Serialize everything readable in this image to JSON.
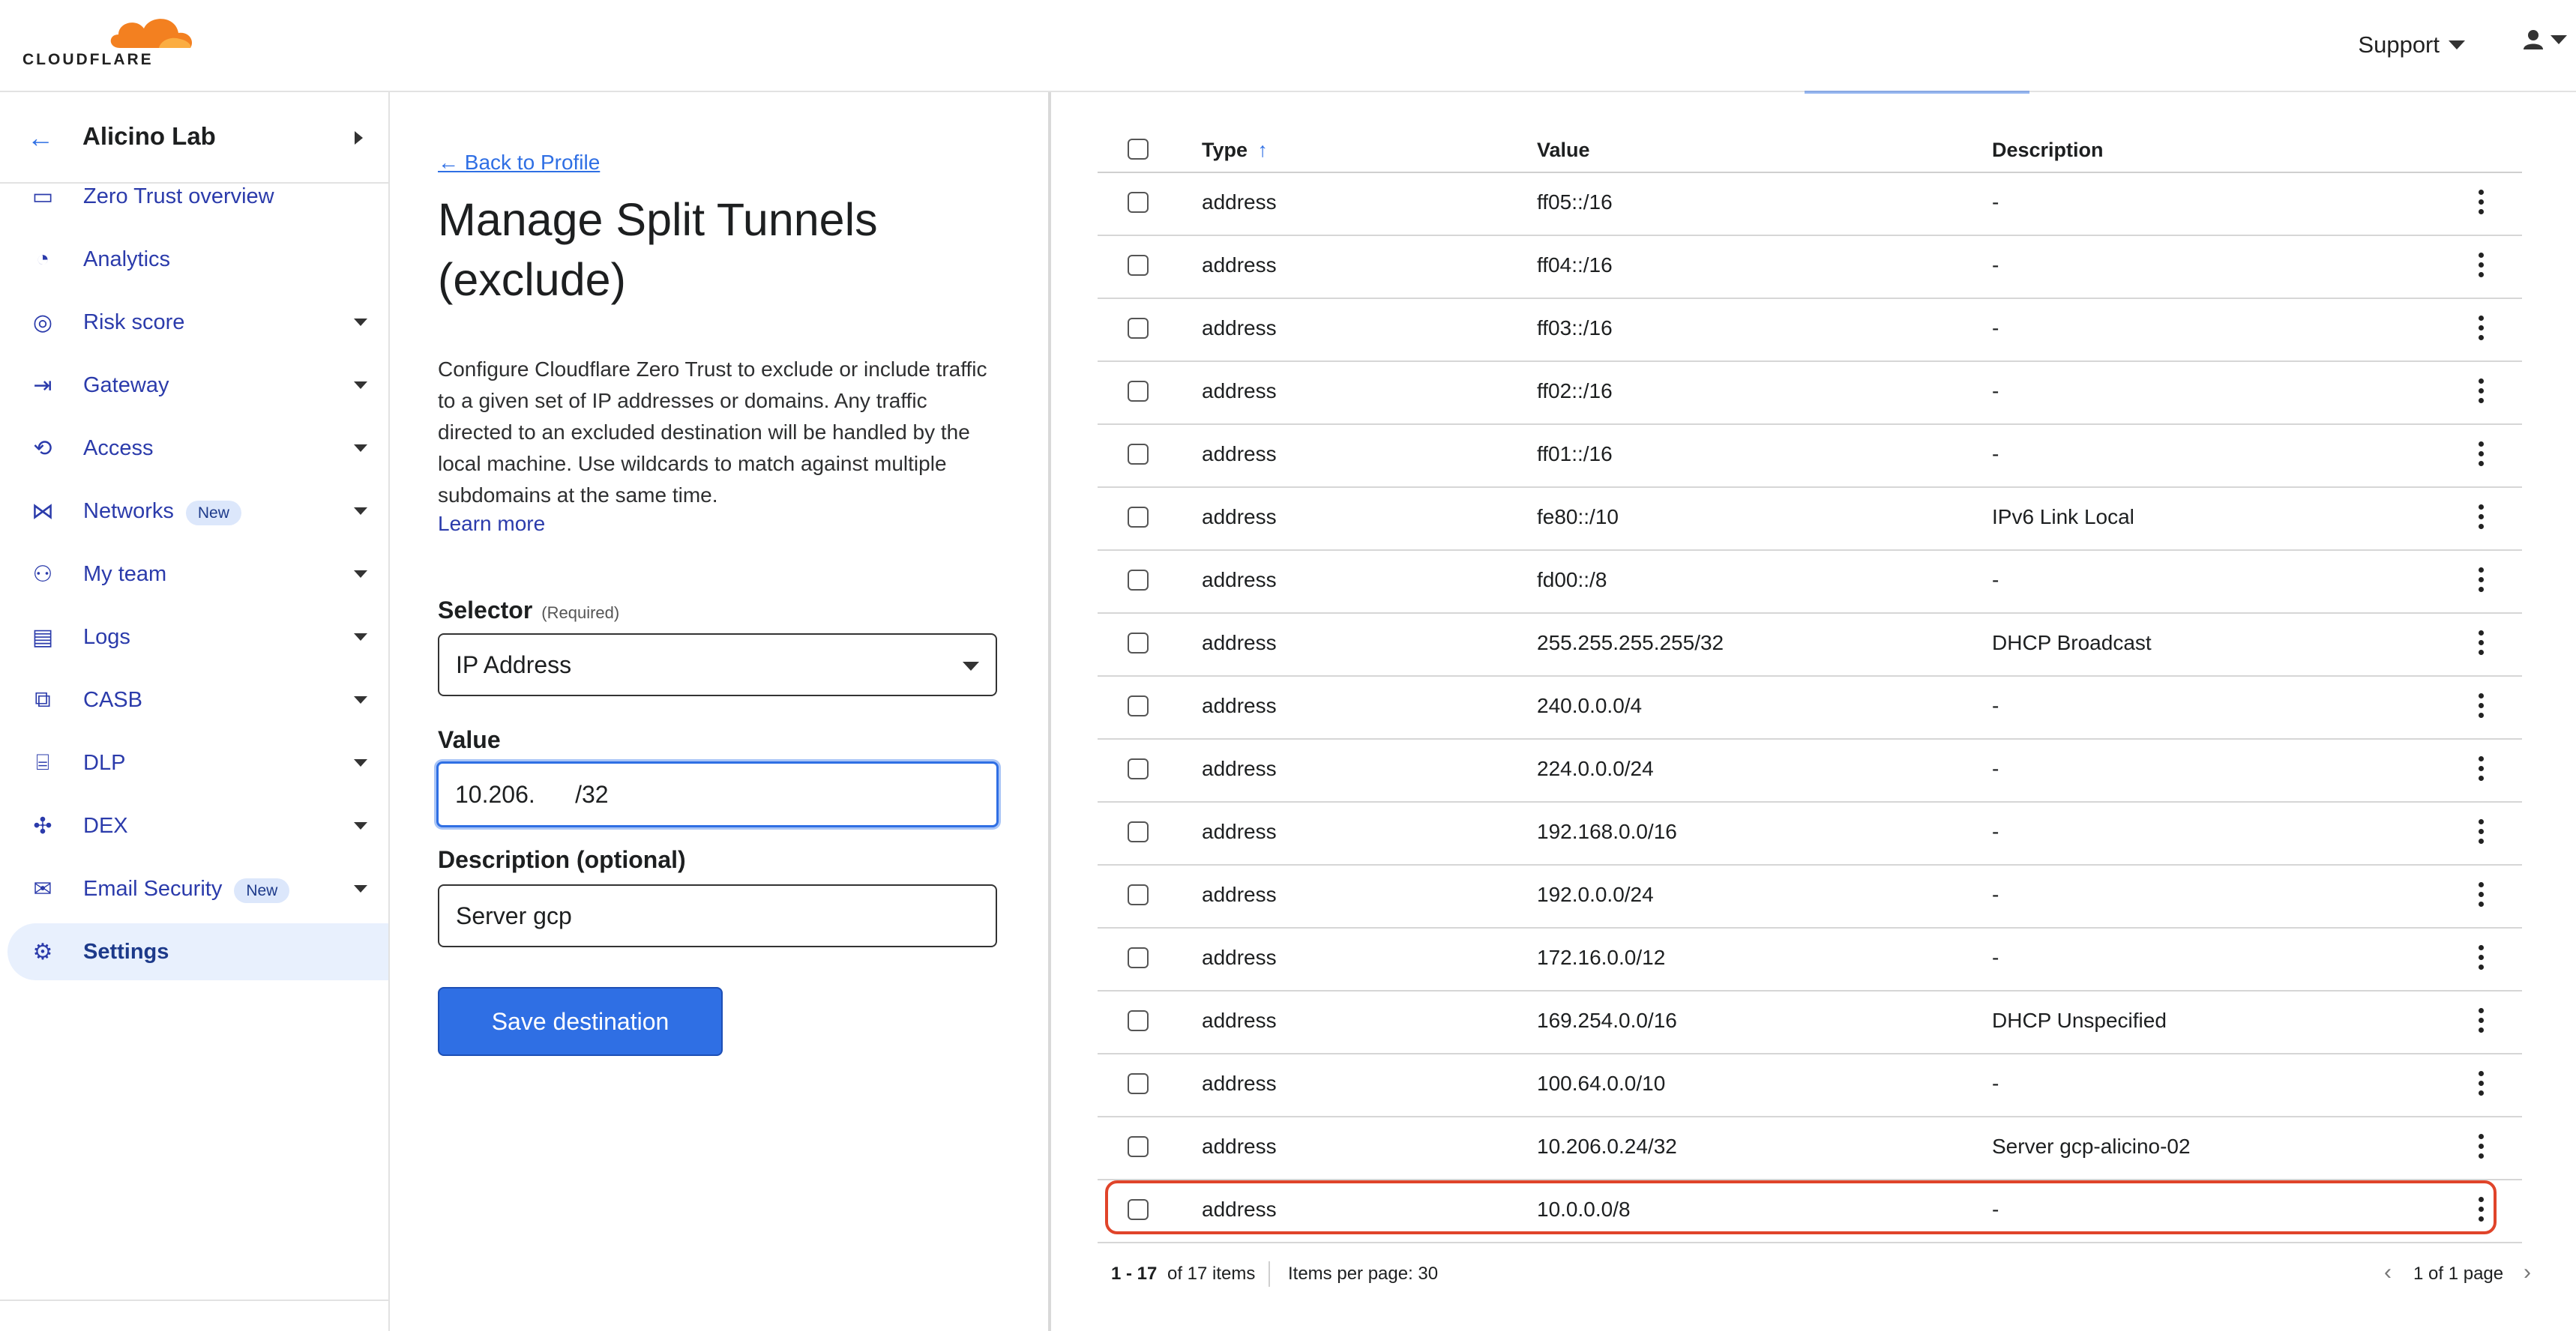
{
  "header": {
    "logo_text": "CLOUDFLARE",
    "support_label": "Support",
    "user_icon": "user-icon"
  },
  "sidebar": {
    "account_name": "Alicino Lab",
    "items": [
      {
        "label": "Zero Trust overview",
        "icon": "window-icon",
        "badge": "",
        "dropdown": false,
        "active": false
      },
      {
        "label": "Analytics",
        "icon": "pie-chart-icon",
        "badge": "",
        "dropdown": false,
        "active": false
      },
      {
        "label": "Risk score",
        "icon": "radar-icon",
        "badge": "",
        "dropdown": true,
        "active": false
      },
      {
        "label": "Gateway",
        "icon": "gateway-icon",
        "badge": "",
        "dropdown": true,
        "active": false
      },
      {
        "label": "Access",
        "icon": "access-icon",
        "badge": "",
        "dropdown": true,
        "active": false
      },
      {
        "label": "Networks",
        "icon": "network-icon",
        "badge": "New",
        "dropdown": true,
        "active": false
      },
      {
        "label": "My team",
        "icon": "team-icon",
        "badge": "",
        "dropdown": true,
        "active": false
      },
      {
        "label": "Logs",
        "icon": "logs-icon",
        "badge": "",
        "dropdown": true,
        "active": false
      },
      {
        "label": "CASB",
        "icon": "casb-icon",
        "badge": "",
        "dropdown": true,
        "active": false
      },
      {
        "label": "DLP",
        "icon": "dlp-icon",
        "badge": "",
        "dropdown": true,
        "active": false
      },
      {
        "label": "DEX",
        "icon": "dex-icon",
        "badge": "",
        "dropdown": true,
        "active": false
      },
      {
        "label": "Email Security",
        "icon": "email-shield-icon",
        "badge": "New",
        "dropdown": true,
        "active": false
      },
      {
        "label": "Settings",
        "icon": "gear-icon",
        "badge": "",
        "dropdown": false,
        "active": true
      }
    ]
  },
  "form": {
    "back_label": "← Back to Profile",
    "title": "Manage Split Tunnels (exclude)",
    "description": "Configure Cloudflare Zero Trust to exclude or include traffic to a given set of IP addresses or domains. Any traffic directed to an excluded destination will be handled by the local machine. Use wildcards to match against multiple subdomains at the same time.",
    "learn_more": "Learn more",
    "selector_label": "Selector",
    "selector_required": "(Required)",
    "selector_value": "IP Address",
    "value_label": "Value",
    "value_text": "10.206.      /32",
    "description_label": "Description (optional)",
    "description_value": "Server gcp",
    "save_label": "Save destination"
  },
  "table": {
    "headers": {
      "type": "Type",
      "value": "Value",
      "description": "Description"
    },
    "rows": [
      {
        "type": "address",
        "value": "ff05::/16",
        "description": "-"
      },
      {
        "type": "address",
        "value": "ff04::/16",
        "description": "-"
      },
      {
        "type": "address",
        "value": "ff03::/16",
        "description": "-"
      },
      {
        "type": "address",
        "value": "ff02::/16",
        "description": "-"
      },
      {
        "type": "address",
        "value": "ff01::/16",
        "description": "-"
      },
      {
        "type": "address",
        "value": "fe80::/10",
        "description": "IPv6 Link Local"
      },
      {
        "type": "address",
        "value": "fd00::/8",
        "description": "-"
      },
      {
        "type": "address",
        "value": "255.255.255.255/32",
        "description": "DHCP Broadcast"
      },
      {
        "type": "address",
        "value": "240.0.0.0/4",
        "description": "-"
      },
      {
        "type": "address",
        "value": "224.0.0.0/24",
        "description": "-"
      },
      {
        "type": "address",
        "value": "192.168.0.0/16",
        "description": "-"
      },
      {
        "type": "address",
        "value": "192.0.0.0/24",
        "description": "-"
      },
      {
        "type": "address",
        "value": "172.16.0.0/12",
        "description": "-"
      },
      {
        "type": "address",
        "value": "169.254.0.0/16",
        "description": "DHCP Unspecified"
      },
      {
        "type": "address",
        "value": "100.64.0.0/10",
        "description": "-"
      },
      {
        "type": "address",
        "value": "10.206.0.24/32",
        "description": "Server gcp-alicino-02"
      },
      {
        "type": "address",
        "value": "10.0.0.0/8",
        "description": "-"
      }
    ],
    "pagination": {
      "range": "1 - 17",
      "of_items": "of 17 items",
      "per_page": "Items per page: 30",
      "page_info": "1 of 1 page"
    }
  },
  "colors": {
    "accent": "#2f6fe4",
    "highlight": "#e0442a",
    "brand_orange": "#f38020"
  }
}
